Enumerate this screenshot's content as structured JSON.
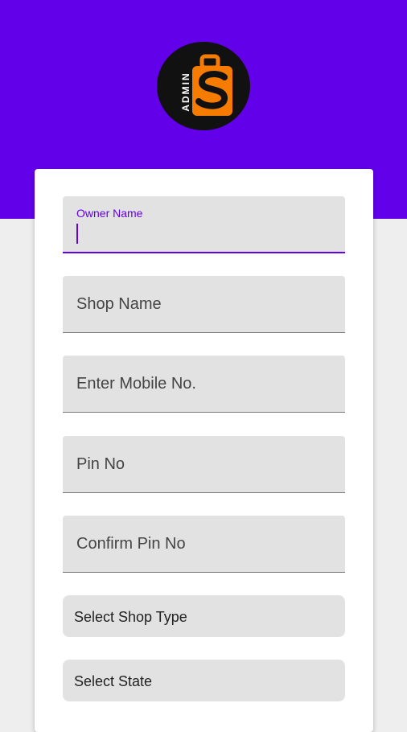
{
  "header": {
    "logo_text": "ADMIN",
    "brand_color": "#6200ea",
    "logo_accent": "#f57c00"
  },
  "form": {
    "owner_name": {
      "label": "Owner Name",
      "value": ""
    },
    "shop_name": {
      "placeholder": "Shop Name"
    },
    "mobile": {
      "placeholder": "Enter Mobile No."
    },
    "pin": {
      "placeholder": "Pin No"
    },
    "confirm_pin": {
      "placeholder": "Confirm Pin No"
    },
    "shop_type": {
      "label": "Select Shop Type"
    },
    "state": {
      "label": "Select State"
    }
  }
}
